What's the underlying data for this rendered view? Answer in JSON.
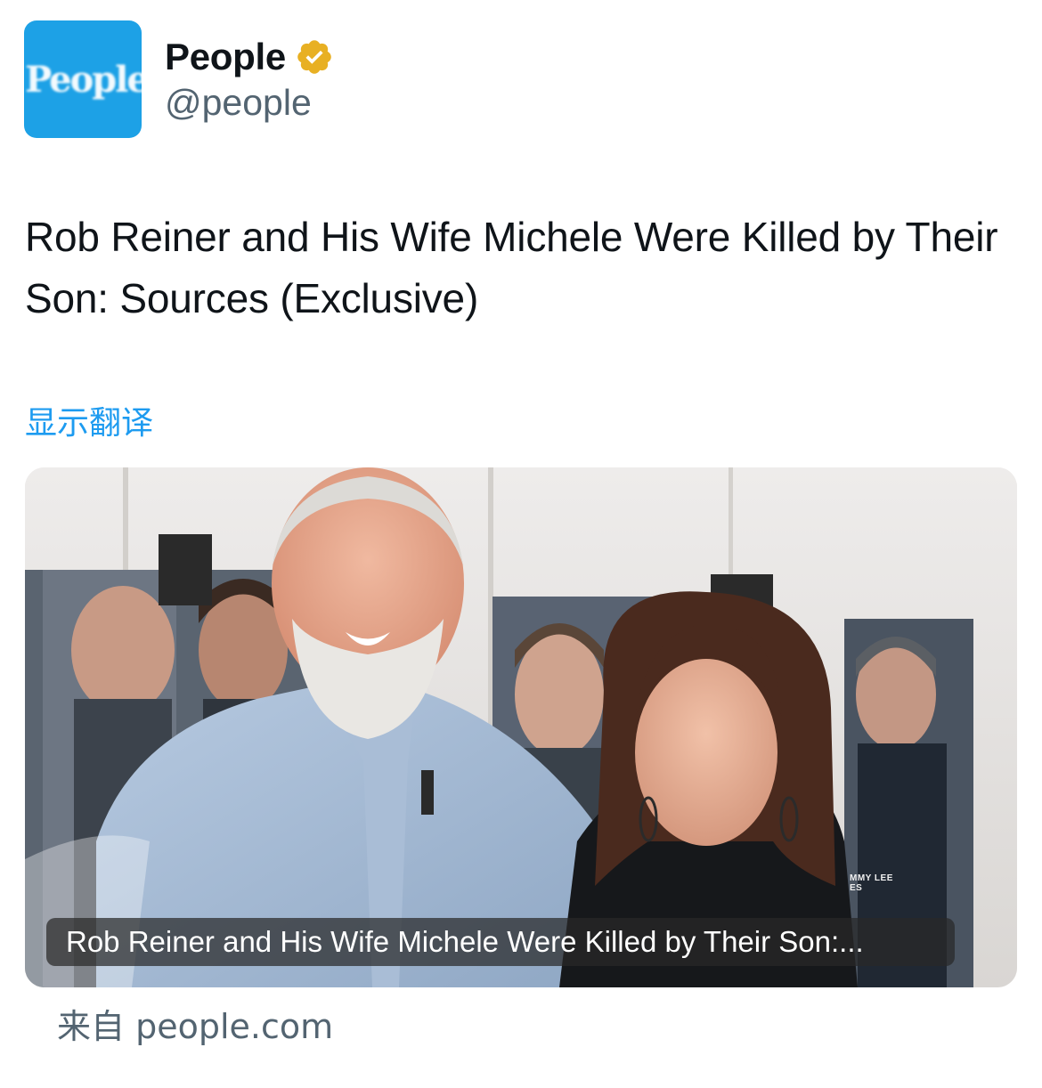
{
  "author": {
    "avatar_logo_text": "People",
    "display_name": "People",
    "handle": "@people",
    "verified_badge": "gold-verified-badge-icon"
  },
  "tweet": {
    "text": "Rob Reiner and His Wife Michele Were Killed by Their Son: Sources (Exclusive)",
    "translate_label": "显示翻译"
  },
  "link_card": {
    "poster_text_line1": "MMY LEE",
    "poster_text_line2": "ES",
    "caption": "Rob Reiner and His Wife Michele Were Killed by Their Son:...",
    "source_label": "来自 people.com"
  },
  "colors": {
    "avatar_bg": "#1da1e6",
    "link": "#1d9bf0",
    "secondary_text": "#536471",
    "verified_gold": "#e8b023"
  }
}
